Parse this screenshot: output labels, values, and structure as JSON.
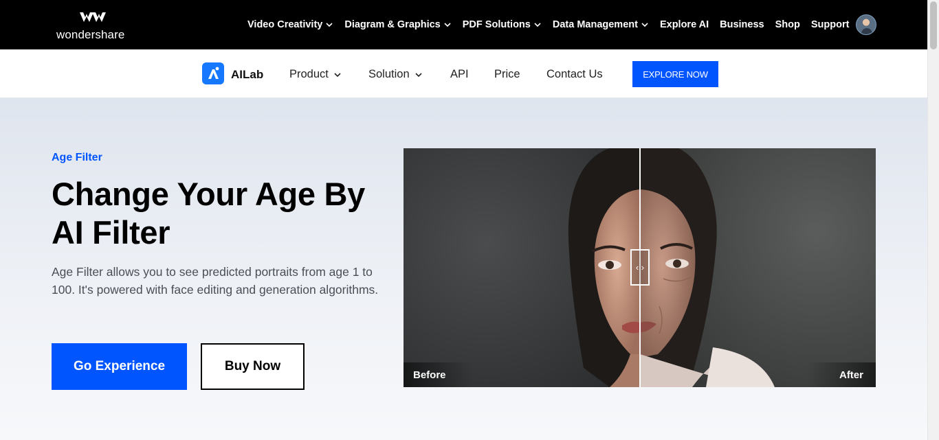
{
  "topbar": {
    "brand": "wondershare",
    "nav": [
      {
        "label": "Video Creativity",
        "has_dropdown": true
      },
      {
        "label": "Diagram & Graphics",
        "has_dropdown": true
      },
      {
        "label": "PDF Solutions",
        "has_dropdown": true
      },
      {
        "label": "Data Management",
        "has_dropdown": true
      },
      {
        "label": "Explore AI",
        "has_dropdown": false
      },
      {
        "label": "Business",
        "has_dropdown": false
      },
      {
        "label": "Shop",
        "has_dropdown": false
      },
      {
        "label": "Support",
        "has_dropdown": false
      }
    ]
  },
  "subnav": {
    "product_name": "AILab",
    "links": {
      "product": "Product",
      "solution": "Solution",
      "api": "API",
      "price": "Price",
      "contact": "Contact Us"
    },
    "cta": "EXPLORE NOW"
  },
  "hero": {
    "eyebrow": "Age Filter",
    "title": "Change Your Age By AI Filter",
    "description": "Age Filter allows you to see predicted portraits from age 1 to 100. It's powered with face editing and generation algorithms.",
    "primary_button": "Go Experience",
    "secondary_button": "Buy Now"
  },
  "compare": {
    "before_label": "Before",
    "after_label": "After",
    "handle_glyph": "‹ ›",
    "split_fraction": 0.5
  },
  "colors": {
    "brand_blue": "#0055ff",
    "topbar_bg": "#000000"
  }
}
